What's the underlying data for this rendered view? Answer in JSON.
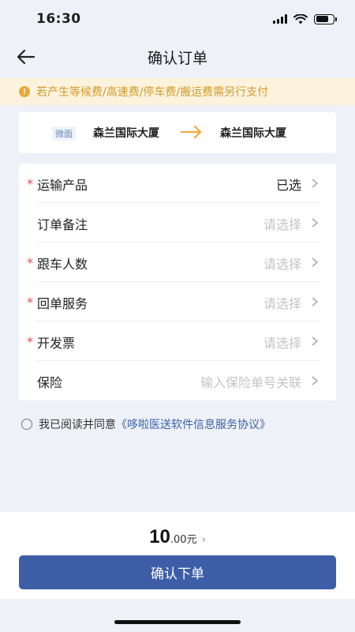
{
  "status_bar": {
    "time": "16:30"
  },
  "nav": {
    "title": "确认订单",
    "back_icon": "arrow-left-icon"
  },
  "notice": {
    "icon": "exclamation-icon",
    "text": "若产生等候费/高速费/停车费/搬运费需另行支付",
    "color": "#d19a2a"
  },
  "route": {
    "tag": "微面",
    "from": "森兰国际大厦",
    "to": "森兰国际大厦",
    "arrow_color": "#f0a93a"
  },
  "form": {
    "rows": [
      {
        "label": "运输产品",
        "value": "已选",
        "required": true,
        "selected": true
      },
      {
        "label": "订单备注",
        "value": "请选择",
        "required": false,
        "selected": false
      },
      {
        "label": "跟车人数",
        "value": "请选择",
        "required": true,
        "selected": false
      },
      {
        "label": "回单服务",
        "value": "请选择",
        "required": true,
        "selected": false
      },
      {
        "label": "开发票",
        "value": "请选择",
        "required": true,
        "selected": false
      },
      {
        "label": "保险",
        "value": "输入保险单号关联",
        "required": false,
        "selected": false
      }
    ]
  },
  "agreement": {
    "prefix": "我已阅读并同意",
    "link": "《哆啦医送软件信息服务协议》"
  },
  "bottom": {
    "price_int": "10",
    "price_dec": ".00",
    "price_unit": "元",
    "price_chevron": "›",
    "confirm_label": "确认下单",
    "accent": "#3d5ea7"
  }
}
